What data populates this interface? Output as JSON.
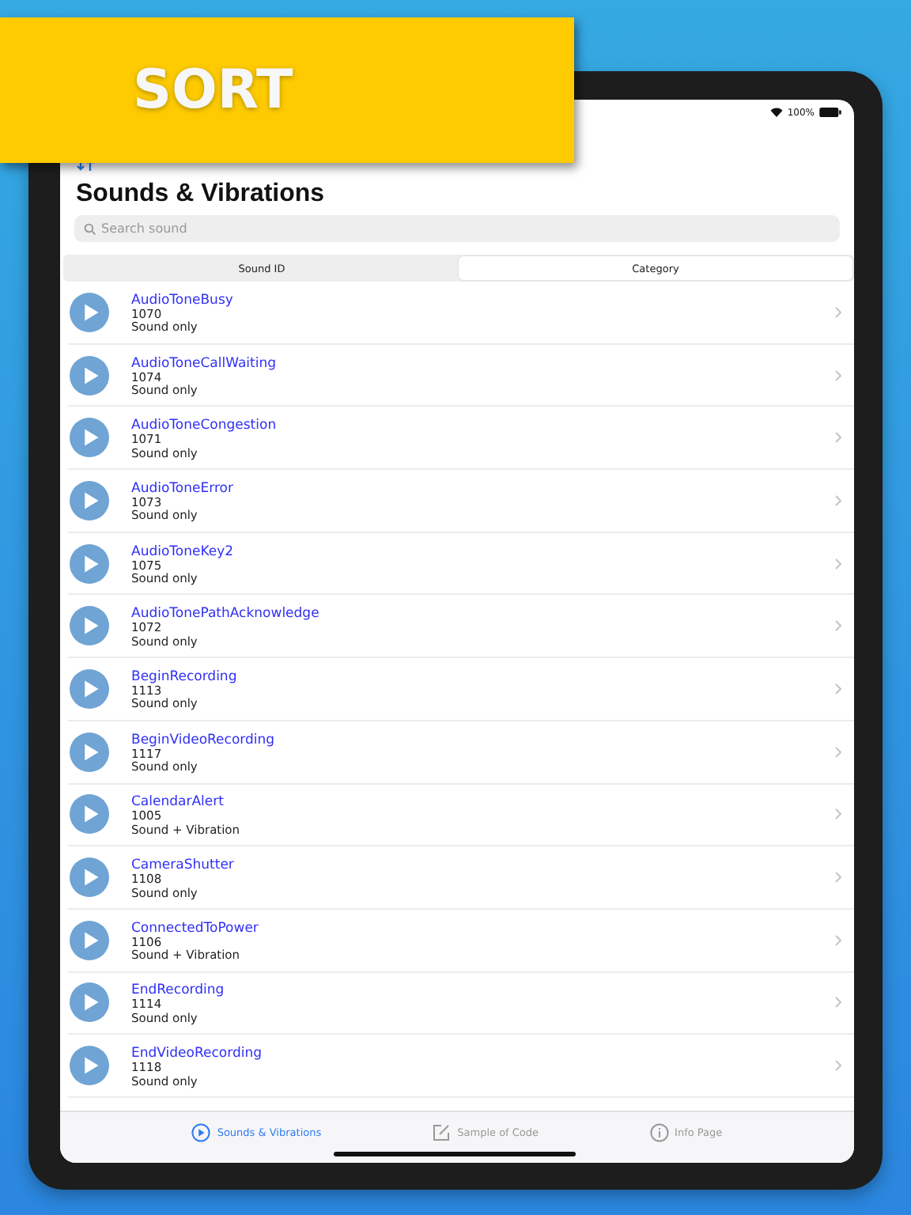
{
  "banner": {
    "title": "SORT"
  },
  "status_bar": {
    "battery": "100%"
  },
  "title": "Sounds & Vibrations",
  "search": {
    "placeholder": "Search sound"
  },
  "segments": [
    {
      "label": "Sound ID",
      "selected": false
    },
    {
      "label": "Category",
      "selected": true
    }
  ],
  "sounds": [
    {
      "name": "AudioToneBusy",
      "id": "1070",
      "type": "Sound only"
    },
    {
      "name": "AudioToneCallWaiting",
      "id": "1074",
      "type": "Sound only"
    },
    {
      "name": "AudioToneCongestion",
      "id": "1071",
      "type": "Sound only"
    },
    {
      "name": "AudioToneError",
      "id": "1073",
      "type": "Sound only"
    },
    {
      "name": "AudioToneKey2",
      "id": "1075",
      "type": "Sound only"
    },
    {
      "name": "AudioTonePathAcknowledge",
      "id": "1072",
      "type": "Sound only"
    },
    {
      "name": "BeginRecording",
      "id": "1113",
      "type": "Sound only"
    },
    {
      "name": "BeginVideoRecording",
      "id": "1117",
      "type": "Sound only"
    },
    {
      "name": "CalendarAlert",
      "id": "1005",
      "type": "Sound + Vibration"
    },
    {
      "name": "CameraShutter",
      "id": "1108",
      "type": "Sound only"
    },
    {
      "name": "ConnectedToPower",
      "id": "1106",
      "type": "Sound + Vibration"
    },
    {
      "name": "EndRecording",
      "id": "1114",
      "type": "Sound only"
    },
    {
      "name": "EndVideoRecording",
      "id": "1118",
      "type": "Sound only"
    }
  ],
  "tabs": [
    {
      "label": "Sounds & Vibrations",
      "kind": "play",
      "selected": true
    },
    {
      "label": "Sample of Code",
      "kind": "edit",
      "selected": false
    },
    {
      "label": "Info Page",
      "kind": "info",
      "selected": false
    }
  ]
}
